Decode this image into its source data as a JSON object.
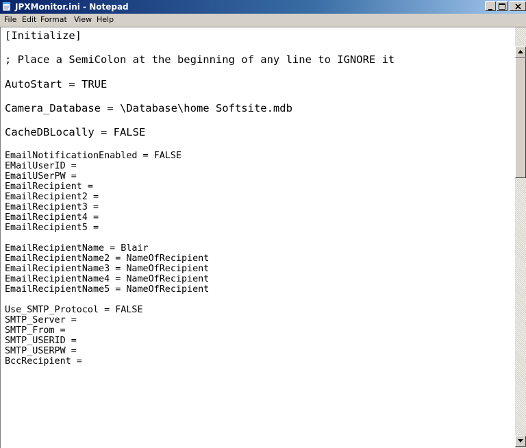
{
  "window": {
    "title": "JPXMonitor.ini - Notepad",
    "icon": "notepad-icon",
    "title_gradient": [
      "#0a246a",
      "#a6caf0"
    ]
  },
  "menu": [
    {
      "label": "File"
    },
    {
      "label": "Edit"
    },
    {
      "label": "Format"
    },
    {
      "label": "View"
    },
    {
      "label": "Help"
    }
  ],
  "editor": {
    "lines": [
      "[Initialize]",
      "",
      "; Place a SemiColon at the beginning of any line to IGNORE it",
      "",
      "AutoStart = TRUE",
      "",
      "Camera_Database = \\Database\\home Softsite.mdb",
      "",
      "CacheDBLocally = FALSE",
      "",
      "EmailNotificationEnabled = FALSE",
      "EMailUserID =",
      "EmailUSerPW =",
      "EmailRecipient =",
      "EmailRecipient2 =",
      "EmailRecipient3 =",
      "EmailRecipient4 =",
      "EmailRecipient5 =",
      "",
      "EmailRecipientName = Blair",
      "EmailRecipientName2 = NameOfRecipient",
      "EmailRecipientName3 = NameOfRecipient",
      "EmailRecipientName4 = NameOfRecipient",
      "EmailRecipientName5 = NameOfRecipient",
      "",
      "Use_SMTP_Protocol = FALSE",
      "SMTP_Server =",
      "SMTP_From =",
      "SMTP_USERID =",
      "SMTP_USERPW =",
      "BccRecipient ="
    ]
  },
  "scrollbar": {
    "up_icon": "arrow-up-icon",
    "down_icon": "arrow-down-icon"
  }
}
